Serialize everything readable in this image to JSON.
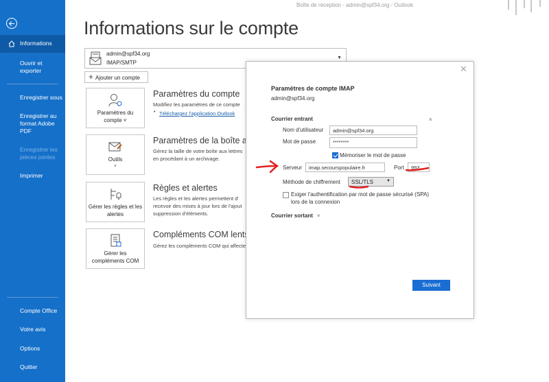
{
  "titlebar": {
    "text": "Boîte de réception - admin@spf34.org  -  Outlook"
  },
  "sidebar": {
    "items": [
      {
        "label": "Informations"
      },
      {
        "label": "Ouvrir et exporter"
      },
      {
        "label": "Enregistrer sous"
      },
      {
        "label": "Enregistrer au format Adobe PDF"
      },
      {
        "label": "Enregistrer les pièces jointes"
      },
      {
        "label": "Imprimer"
      },
      {
        "label": "Compte Office"
      },
      {
        "label": "Votre avis"
      },
      {
        "label": "Options"
      },
      {
        "label": "Quitter"
      }
    ]
  },
  "main": {
    "title": "Informations sur le compte",
    "account": {
      "email": "admin@spf34.org",
      "type": "IMAP/SMTP"
    },
    "add_account": "Ajouter un compte",
    "sections": [
      {
        "tile": "Paramètres du compte ˅",
        "title": "Paramètres du compte",
        "desc": "Modifiez les paramètres de ce compte",
        "link": "Téléchargez l'application Outlook"
      },
      {
        "tile": "Outils",
        "title": "Paramètres de la boîte aux lettres",
        "desc1": "Gérez la taille de votre boîte aux lettres",
        "desc2": "en procédant à un archivage."
      },
      {
        "tile": "Gérer les règles et les alertes",
        "title": "Règles et alertes",
        "desc1": "Les règles et les alertes permettent d'",
        "desc2": "recevoir des mises à jour lors de l'ajout",
        "desc3": "suppression d'éléments."
      },
      {
        "tile": "Gérer les compléments COM",
        "title": "Compléments COM lents",
        "desc": "Gérez les compléments COM qui affectent"
      }
    ]
  },
  "dialog": {
    "title": "Paramètres de compte IMAP",
    "subtitle": "admin@spf34.org",
    "incoming_head": "Courrier entrant",
    "username_label": "Nom d'utilisateur",
    "username_value": "admin@spf34.org",
    "password_label": "Mot de passe",
    "password_value": "********",
    "remember_label": "Mémoriser le mot de passe",
    "server_label": "Serveur",
    "server_value": "imap.secourspopulaire.fr",
    "port_label": "Port",
    "port_value": "993",
    "encryption_label": "Méthode de chiffrement",
    "encryption_value": "SSL/TLS",
    "spa_label_1": "Exiger l'authentification par mot de passe sécurisé (SPA)",
    "spa_label_2": "lors de la connexion",
    "outgoing_head": "Courrier sortant",
    "next_button": "Suivant"
  },
  "colors": {
    "sidebar": "#1570c9",
    "accent": "#1a6dd2",
    "annotation": "#e02020"
  }
}
